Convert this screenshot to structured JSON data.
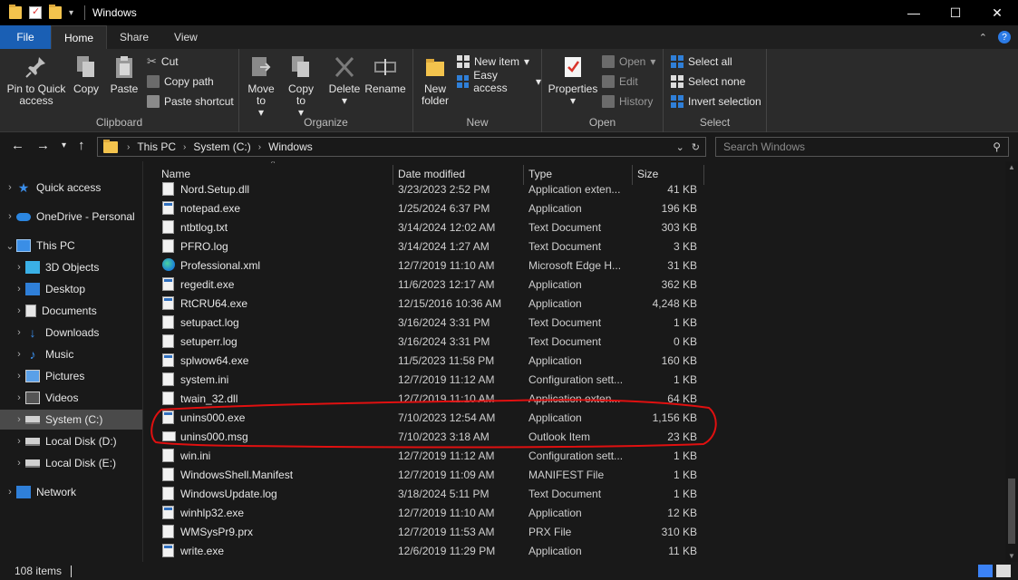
{
  "window": {
    "title": "Windows"
  },
  "tabs": [
    "File",
    "Home",
    "Share",
    "View"
  ],
  "ribbon": {
    "clipboard": {
      "label": "Clipboard",
      "pin": "Pin to Quick access",
      "copy": "Copy",
      "paste": "Paste",
      "cut": "Cut",
      "copy_path": "Copy path",
      "paste_shortcut": "Paste shortcut"
    },
    "organize": {
      "label": "Organize",
      "move_to": "Move to",
      "copy_to": "Copy to",
      "delete": "Delete",
      "rename": "Rename"
    },
    "new": {
      "label": "New",
      "new_folder": "New folder",
      "new_item": "New item",
      "easy_access": "Easy access"
    },
    "open": {
      "label": "Open",
      "properties": "Properties",
      "open": "Open",
      "edit": "Edit",
      "history": "History"
    },
    "select": {
      "label": "Select",
      "select_all": "Select all",
      "select_none": "Select none",
      "invert_selection": "Invert selection"
    }
  },
  "address": {
    "crumbs": [
      "This PC",
      "System (C:)",
      "Windows"
    ],
    "search_placeholder": "Search Windows"
  },
  "sidebar": [
    {
      "label": "Quick access",
      "icon": "star-icon",
      "level": 0
    },
    {
      "label": "OneDrive - Personal",
      "icon": "cloud-icon",
      "level": 0
    },
    {
      "label": "This PC",
      "icon": "computer-icon",
      "level": 0,
      "expanded": true
    },
    {
      "label": "3D Objects",
      "icon": "cube-icon",
      "level": 1
    },
    {
      "label": "Desktop",
      "icon": "desktop-icon",
      "level": 1
    },
    {
      "label": "Documents",
      "icon": "documents-icon",
      "level": 1
    },
    {
      "label": "Downloads",
      "icon": "download-icon",
      "level": 1
    },
    {
      "label": "Music",
      "icon": "music-icon",
      "level": 1
    },
    {
      "label": "Pictures",
      "icon": "pictures-icon",
      "level": 1
    },
    {
      "label": "Videos",
      "icon": "videos-icon",
      "level": 1
    },
    {
      "label": "System (C:)",
      "icon": "drive-icon",
      "level": 1,
      "selected": true
    },
    {
      "label": "Local Disk (D:)",
      "icon": "drive-icon",
      "level": 1
    },
    {
      "label": "Local Disk (E:)",
      "icon": "drive-icon",
      "level": 1
    },
    {
      "label": "Network",
      "icon": "network-icon",
      "level": 0
    }
  ],
  "columns": {
    "name": "Name",
    "date": "Date modified",
    "type": "Type",
    "size": "Size"
  },
  "files": [
    {
      "name": "Nord.Setup.dll",
      "date": "3/23/2023 2:52 PM",
      "type": "Application exten...",
      "size": "41 KB",
      "icon": "dll-icon"
    },
    {
      "name": "notepad.exe",
      "date": "1/25/2024 6:37 PM",
      "type": "Application",
      "size": "196 KB",
      "icon": "exe-icon"
    },
    {
      "name": "ntbtlog.txt",
      "date": "3/14/2024 12:02 AM",
      "type": "Text Document",
      "size": "303 KB",
      "icon": "text-file-icon"
    },
    {
      "name": "PFRO.log",
      "date": "3/14/2024 1:27 AM",
      "type": "Text Document",
      "size": "3 KB",
      "icon": "text-file-icon"
    },
    {
      "name": "Professional.xml",
      "date": "12/7/2019 11:10 AM",
      "type": "Microsoft Edge H...",
      "size": "31 KB",
      "icon": "edge-icon"
    },
    {
      "name": "regedit.exe",
      "date": "11/6/2023 12:17 AM",
      "type": "Application",
      "size": "362 KB",
      "icon": "exe-icon"
    },
    {
      "name": "RtCRU64.exe",
      "date": "12/15/2016 10:36 AM",
      "type": "Application",
      "size": "4,248 KB",
      "icon": "exe-icon"
    },
    {
      "name": "setupact.log",
      "date": "3/16/2024 3:31 PM",
      "type": "Text Document",
      "size": "1 KB",
      "icon": "text-file-icon"
    },
    {
      "name": "setuperr.log",
      "date": "3/16/2024 3:31 PM",
      "type": "Text Document",
      "size": "0 KB",
      "icon": "text-file-icon"
    },
    {
      "name": "splwow64.exe",
      "date": "11/5/2023 11:58 PM",
      "type": "Application",
      "size": "160 KB",
      "icon": "exe-icon"
    },
    {
      "name": "system.ini",
      "date": "12/7/2019 11:12 AM",
      "type": "Configuration sett...",
      "size": "1 KB",
      "icon": "ini-icon"
    },
    {
      "name": "twain_32.dll",
      "date": "12/7/2019 11:10 AM",
      "type": "Application exten...",
      "size": "64 KB",
      "icon": "dll-icon"
    },
    {
      "name": "unins000.exe",
      "date": "7/10/2023 12:54 AM",
      "type": "Application",
      "size": "1,156 KB",
      "icon": "exe-icon"
    },
    {
      "name": "unins000.msg",
      "date": "7/10/2023 3:18 AM",
      "type": "Outlook Item",
      "size": "23 KB",
      "icon": "mail-icon"
    },
    {
      "name": "win.ini",
      "date": "12/7/2019 11:12 AM",
      "type": "Configuration sett...",
      "size": "1 KB",
      "icon": "ini-icon"
    },
    {
      "name": "WindowsShell.Manifest",
      "date": "12/7/2019 11:09 AM",
      "type": "MANIFEST File",
      "size": "1 KB",
      "icon": "file-icon"
    },
    {
      "name": "WindowsUpdate.log",
      "date": "3/18/2024 5:11 PM",
      "type": "Text Document",
      "size": "1 KB",
      "icon": "text-file-icon"
    },
    {
      "name": "winhlp32.exe",
      "date": "12/7/2019 11:10 AM",
      "type": "Application",
      "size": "12 KB",
      "icon": "exe-icon"
    },
    {
      "name": "WMSysPr9.prx",
      "date": "12/7/2019 11:53 AM",
      "type": "PRX File",
      "size": "310 KB",
      "icon": "file-icon"
    },
    {
      "name": "write.exe",
      "date": "12/6/2019 11:29 PM",
      "type": "Application",
      "size": "11 KB",
      "icon": "exe-icon"
    }
  ],
  "status": {
    "item_count": "108 items"
  },
  "colors": {
    "accent": "#1a5fb4",
    "annotation": "#e01010",
    "folder": "#f3c34d",
    "selection": "#4a4a4a"
  }
}
